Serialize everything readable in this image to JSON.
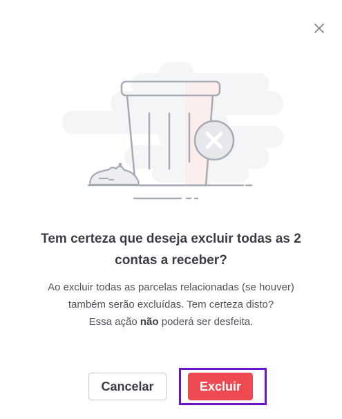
{
  "dialog": {
    "title": "Tem certeza que deseja excluir todas as 2 contas a receber?",
    "description_line1": "Ao excluir todas as parcelas relacionadas (se houver) também serão excluídas. Tem certeza disto?",
    "description_line2_prefix": "Essa ação ",
    "description_line2_bold": "não",
    "description_line2_suffix": " poderá ser desfeita.",
    "cancel_label": "Cancelar",
    "delete_label": "Excluir"
  },
  "icons": {
    "close": "close-icon",
    "illustration": "trash-can-illustration"
  },
  "colors": {
    "primary_danger": "#ee4a52",
    "focus_ring": "#6a14d1",
    "text_primary": "#3a3d45",
    "text_secondary": "#4f535c",
    "illustration_gray": "#a6aab3",
    "illustration_bg": "#f4f5f7"
  }
}
